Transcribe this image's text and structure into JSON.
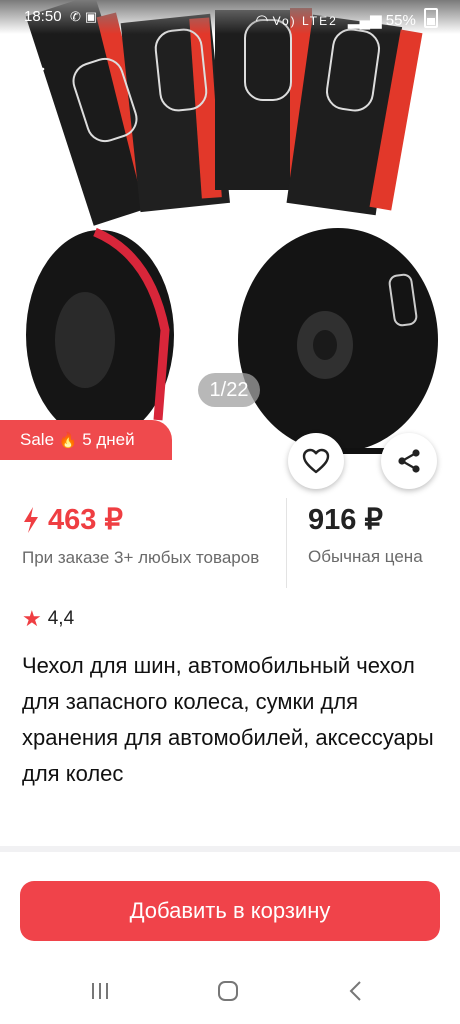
{
  "status_bar": {
    "time": "18:50",
    "network": "Vo) LTE2",
    "battery": "55%"
  },
  "gallery": {
    "counter": "1/22"
  },
  "sale_badge": {
    "label": "Sale",
    "days": "5 дней"
  },
  "price": {
    "main": "463 ₽",
    "main_note": "При заказе 3+ любых товаров",
    "regular": "916 ₽",
    "regular_note": "Обычная цена"
  },
  "rating": {
    "value": "4,4"
  },
  "product": {
    "title": "Чехол для шин, автомобильный чехол для запасного колеса, сумки для хранения для автомобилей, аксессуары для колес"
  },
  "actions": {
    "add_to_cart": "Добавить в корзину"
  },
  "icons": {
    "back": "arrow-left-icon",
    "favorite": "heart-icon",
    "share": "share-icon",
    "rating": "star-icon",
    "price": "lightning-icon",
    "nav_recent": "recent-apps-icon",
    "nav_home": "home-icon",
    "nav_back": "back-icon"
  },
  "colors": {
    "accent": "#ef3e42",
    "badge": "#ef4a4d",
    "button": "#f0434a"
  }
}
